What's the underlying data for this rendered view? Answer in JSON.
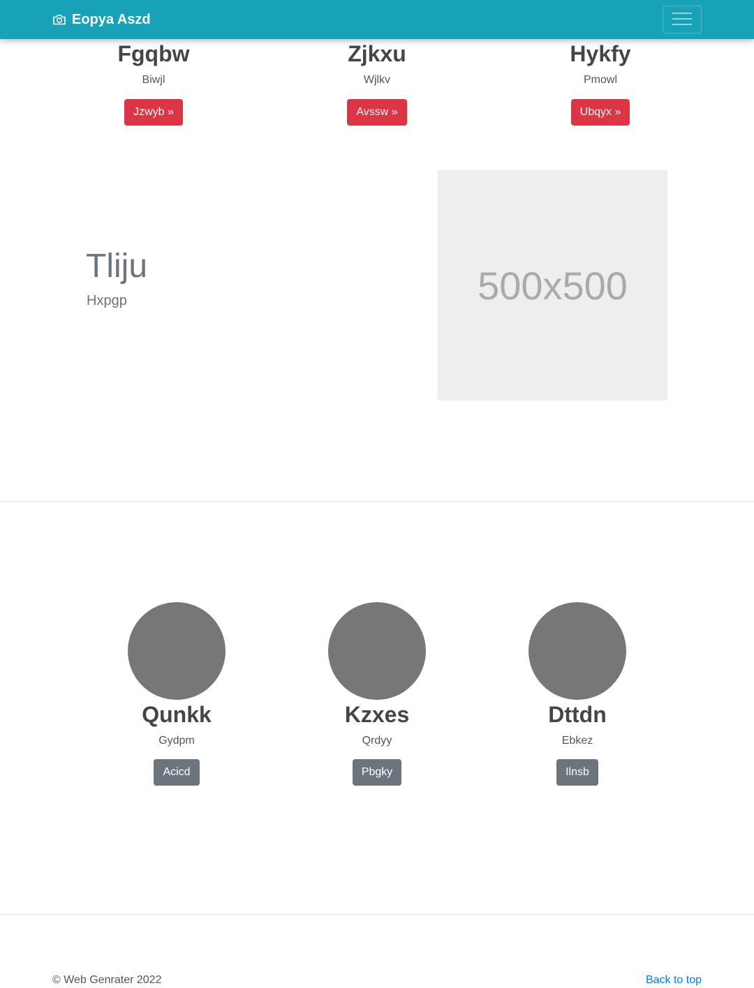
{
  "navbar": {
    "brand": "Eopya Aszd",
    "brand_icon": "camera-icon",
    "menu_icon": "hamburger-menu-icon",
    "background_color": "#17a2b8"
  },
  "features": [
    {
      "title": "Fgqbw",
      "subtitle": "Biwjl",
      "button": "Jzwyb »"
    },
    {
      "title": "Zjkxu",
      "subtitle": "Wjlkv",
      "button": "Avssw »"
    },
    {
      "title": "Hykfy",
      "subtitle": "Pmowl",
      "button": "Ubqyx »"
    }
  ],
  "hero": {
    "title": "Tliju",
    "subtitle": "Hxpgp",
    "image_text": "500x500"
  },
  "team": [
    {
      "name": "Qunkk",
      "subtitle": "Gydpm",
      "button": "Acicd"
    },
    {
      "name": "Kzxes",
      "subtitle": "Qrdyy",
      "button": "Pbgky"
    },
    {
      "name": "Dttdn",
      "subtitle": "Ebkez",
      "button": "Ilnsb"
    }
  ],
  "footer": {
    "copyright": "© Web Genrater 2022",
    "back_to_top": "Back to top"
  },
  "colors": {
    "primary_button": "#dc3545",
    "secondary_button": "#6c757d",
    "link": "#007bff",
    "avatar": "#777777"
  }
}
